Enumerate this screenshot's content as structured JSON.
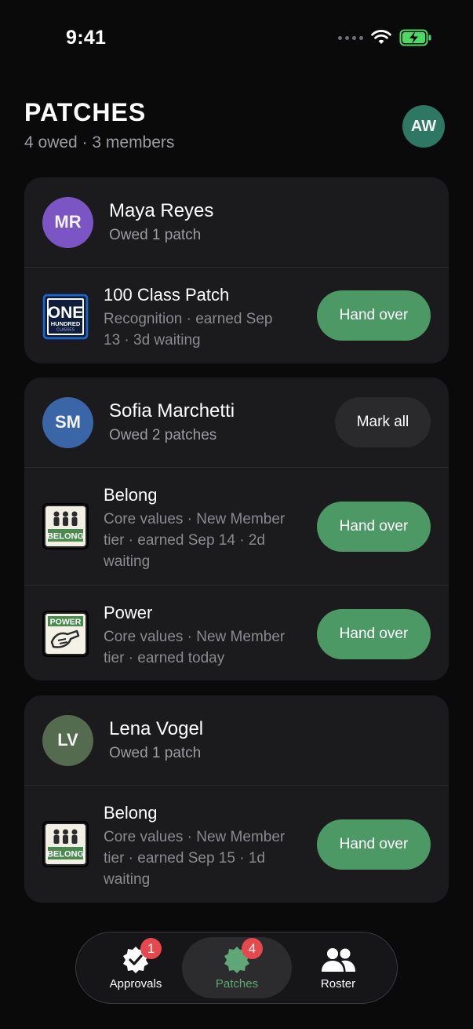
{
  "status": {
    "time": "9:41"
  },
  "header": {
    "title": "PATCHES",
    "subtitle": "4 owed · 3 members",
    "avatar_initials": "AW"
  },
  "members": [
    {
      "initials": "MR",
      "name": "Maya Reyes",
      "owed": "Owed 1 patch",
      "avatar_color": "#7b55c4",
      "patches": [
        {
          "name": "100 Class Patch",
          "line1": "Recognition · earned Sep",
          "line2": "13 · 3d waiting",
          "line3": "",
          "action": "Hand over",
          "icon": "one-hundred-classes-patch"
        }
      ]
    },
    {
      "initials": "SM",
      "name": "Sofia Marchetti",
      "owed": "Owed 2 patches",
      "avatar_color": "#3a66a7",
      "mark_all": "Mark all",
      "patches": [
        {
          "name": "Belong",
          "line1": "Core values · New Member",
          "line2": "tier · earned Sep 14 · 2d",
          "line3": "waiting",
          "action": "Hand over",
          "icon": "belong-patch",
          "icon_text": "BELONG"
        },
        {
          "name": "Power",
          "line1": "Core values · New Member",
          "line2": "tier · earned today",
          "line3": "",
          "action": "Hand over",
          "icon": "power-patch",
          "icon_text": "POWER"
        }
      ]
    },
    {
      "initials": "LV",
      "name": "Lena Vogel",
      "owed": "Owed 1 patch",
      "avatar_color": "#556b4f",
      "patches": [
        {
          "name": "Belong",
          "line1": "Core values · New Member",
          "line2": "tier · earned Sep 15 · 1d",
          "line3": "waiting",
          "action": "Hand over",
          "icon": "belong-patch",
          "icon_text": "BELONG"
        }
      ]
    }
  ],
  "patch_logo": {
    "top": "ONE",
    "middle": "HUNDRED",
    "bottom": "CLASSES"
  },
  "tabbar": {
    "tabs": [
      {
        "label": "Approvals",
        "badge": "1",
        "icon": "approval-check-icon",
        "active": false
      },
      {
        "label": "Patches",
        "badge": "4",
        "icon": "patch-badge-icon",
        "active": true
      },
      {
        "label": "Roster",
        "badge": "",
        "icon": "people-icon",
        "active": false
      }
    ]
  },
  "colors": {
    "accent_green": "#4d9966",
    "active_tab_text": "#5fa776",
    "badge_red": "#e5484d",
    "card_bg": "#1b1b1d"
  }
}
